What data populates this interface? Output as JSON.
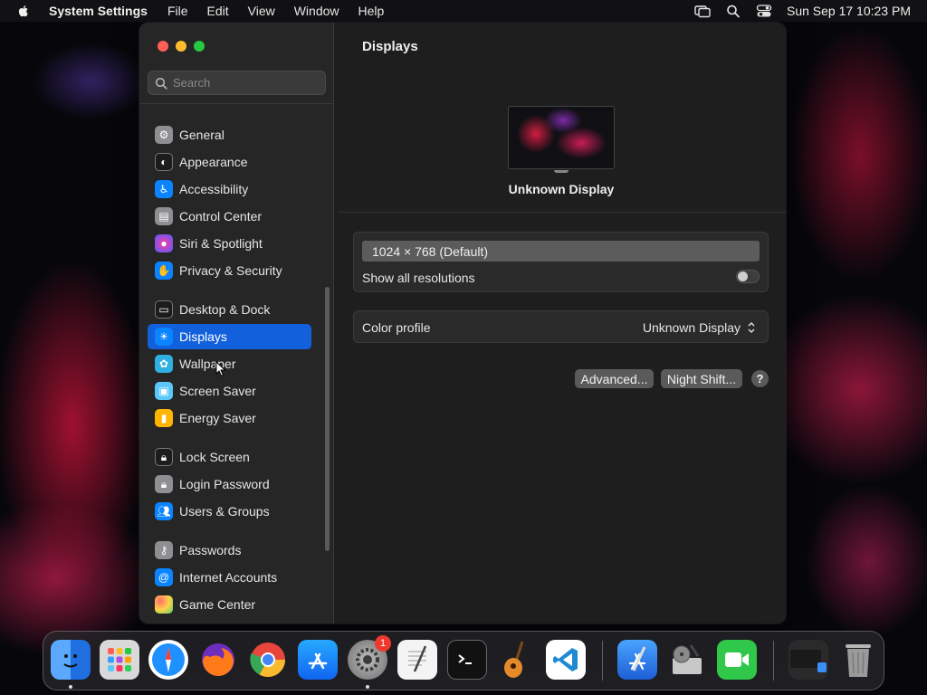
{
  "menubar": {
    "app_name": "System Settings",
    "menus": [
      "File",
      "Edit",
      "View",
      "Window",
      "Help"
    ],
    "clock": "Sun Sep 17  10:23 PM"
  },
  "sidebar": {
    "search_placeholder": "Search",
    "items": [
      {
        "label": "General",
        "icon": "gear-icon",
        "color": "#8e8e93"
      },
      {
        "label": "Appearance",
        "icon": "appearance-icon",
        "color": "#1c1c1e"
      },
      {
        "label": "Accessibility",
        "icon": "accessibility-icon",
        "color": "#0a84ff"
      },
      {
        "label": "Control Center",
        "icon": "control-center-icon",
        "color": "#8e8e93"
      },
      {
        "label": "Siri & Spotlight",
        "icon": "siri-icon",
        "color": "#b04bdc"
      },
      {
        "label": "Privacy & Security",
        "icon": "hand-icon",
        "color": "#0a84ff"
      },
      {
        "label": "Desktop & Dock",
        "icon": "dock-icon",
        "color": "#1c1c1e"
      },
      {
        "label": "Displays",
        "icon": "sun-icon",
        "color": "#0a84ff",
        "selected": true
      },
      {
        "label": "Wallpaper",
        "icon": "wallpaper-icon",
        "color": "#30b0e0"
      },
      {
        "label": "Screen Saver",
        "icon": "screen-saver-icon",
        "color": "#5ac8fa"
      },
      {
        "label": "Energy Saver",
        "icon": "battery-icon",
        "color": "#ffb400"
      },
      {
        "label": "Lock Screen",
        "icon": "lock-icon",
        "color": "#1c1c1e"
      },
      {
        "label": "Login Password",
        "icon": "login-lock-icon",
        "color": "#8e8e93"
      },
      {
        "label": "Users & Groups",
        "icon": "users-icon",
        "color": "#0a84ff"
      },
      {
        "label": "Passwords",
        "icon": "key-icon",
        "color": "#8e8e93"
      },
      {
        "label": "Internet Accounts",
        "icon": "at-icon",
        "color": "#0a84ff"
      },
      {
        "label": "Game Center",
        "icon": "game-center-icon",
        "color": "#ff6b6b"
      }
    ]
  },
  "content": {
    "title": "Displays",
    "display_name": "Unknown Display",
    "resolution": "1024 × 768 (Default)",
    "show_all_label": "Show all resolutions",
    "show_all_enabled": false,
    "color_profile_label": "Color profile",
    "color_profile_value": "Unknown Display",
    "advanced_button": "Advanced...",
    "night_shift_button": "Night Shift...",
    "help_button": "?"
  },
  "dock": {
    "apps": [
      {
        "name": "Finder",
        "icon": "finder-icon",
        "color": "#2b7fe8",
        "running": true
      },
      {
        "name": "Launchpad",
        "icon": "launchpad-icon",
        "color": "#d9d9d9"
      },
      {
        "name": "Safari",
        "icon": "safari-icon",
        "color": "#1e90ff"
      },
      {
        "name": "Firefox",
        "icon": "firefox-icon",
        "color": "#ff7a18"
      },
      {
        "name": "Chrome",
        "icon": "chrome-icon",
        "color": "#e8453c"
      },
      {
        "name": "App Store",
        "icon": "app-store-icon",
        "color": "#1a8cff"
      },
      {
        "name": "System Settings",
        "icon": "system-settings-icon",
        "color": "#8a8a8a",
        "running": true
      },
      {
        "name": "TextEdit",
        "icon": "textedit-icon",
        "color": "#f4f4f4"
      },
      {
        "name": "Terminal",
        "icon": "terminal-icon",
        "color": "#111111"
      },
      {
        "name": "GarageBand",
        "icon": "garageband-icon",
        "color": "#e58a2a"
      },
      {
        "name": "Visual Studio Code",
        "icon": "vscode-icon",
        "color": "#ffffff"
      },
      {
        "name": "Xcode",
        "icon": "xcode-icon",
        "color": "#2f86e8"
      },
      {
        "name": "Disk Utility",
        "icon": "disk-utility-icon",
        "color": "#c8c8c8"
      },
      {
        "name": "FaceTime",
        "icon": "facetime-icon",
        "color": "#2fc84a"
      },
      {
        "name": "Downloads",
        "icon": "downloads-stack-icon",
        "color": "#303030"
      },
      {
        "name": "Trash",
        "icon": "trash-icon",
        "color": "#9a9a9a"
      }
    ],
    "settings_badge": "1"
  }
}
